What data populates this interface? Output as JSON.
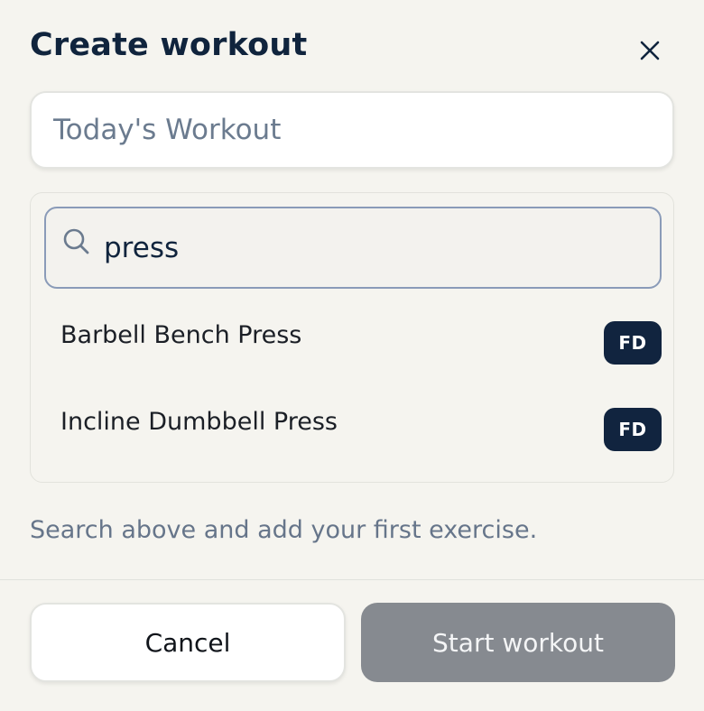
{
  "dialog": {
    "title": "Create workout",
    "close_icon": "close-icon"
  },
  "workout_name": {
    "value": "",
    "placeholder": "Today's Workout"
  },
  "exercise_search": {
    "icon": "search-icon",
    "value": "press",
    "results": [
      {
        "label": "Barbell Bench Press",
        "badge": "FD"
      },
      {
        "label": "Incline Dumbbell Press",
        "badge": "FD"
      }
    ]
  },
  "helper_text": "Search above and add your first exercise.",
  "footer": {
    "cancel_label": "Cancel",
    "start_label": "Start workout"
  },
  "colors": {
    "background": "#f5f4ef",
    "title": "#10243d",
    "badge": "#11243f",
    "search_border": "#8a9bb8",
    "start_button_disabled": "#868a90"
  }
}
